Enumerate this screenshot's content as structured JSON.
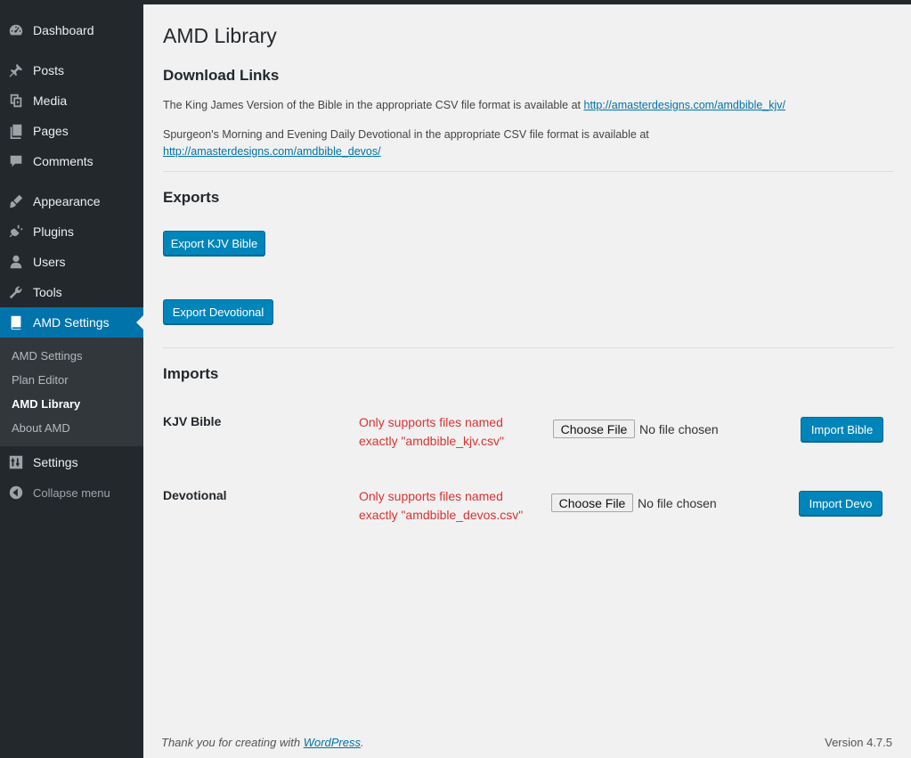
{
  "sidebar": {
    "items": [
      {
        "label": "Dashboard",
        "icon": "dashboard-icon"
      },
      {
        "label": "Posts",
        "icon": "pin-icon"
      },
      {
        "label": "Media",
        "icon": "media-icon"
      },
      {
        "label": "Pages",
        "icon": "pages-icon"
      },
      {
        "label": "Comments",
        "icon": "comment-icon"
      },
      {
        "label": "Appearance",
        "icon": "brush-icon"
      },
      {
        "label": "Plugins",
        "icon": "plugin-icon"
      },
      {
        "label": "Users",
        "icon": "user-icon"
      },
      {
        "label": "Tools",
        "icon": "wrench-icon"
      },
      {
        "label": "AMD Settings",
        "icon": "book-icon"
      }
    ],
    "submenu": [
      "AMD Settings",
      "Plan Editor",
      "AMD Library",
      "About AMD"
    ],
    "settings": "Settings",
    "collapse": "Collapse menu",
    "accent": "#0073aa"
  },
  "page": {
    "title": "AMD Library",
    "downloads": {
      "heading": "Download Links",
      "kjv_text": "The King James Version of the Bible in the appropriate CSV file format is available at",
      "kjv_link": "http://amasterdesigns.com/amdbible_kjv/",
      "devo_text": "Spurgeon's Morning and Evening Daily Devotional in the appropriate CSV file format is available at",
      "devo_link": "http://amasterdesigns.com/amdbible_devos/"
    },
    "exports": {
      "heading": "Exports",
      "kjv_button": "Export KJV Bible",
      "devo_button": "Export Devotional"
    },
    "imports": {
      "heading": "Imports",
      "rows": [
        {
          "label": "KJV Bible",
          "note1": "Only supports files named",
          "note2": "exactly \"amdbible_kjv.csv\"",
          "choose": "Choose File",
          "nofile": "No file chosen",
          "button": "Import Bible"
        },
        {
          "label": "Devotional",
          "note1": "Only supports files named",
          "note2": "exactly \"amdbible_devos.csv\"",
          "choose": "Choose File",
          "nofile": "No file chosen",
          "button": "Import Devo"
        }
      ]
    }
  },
  "footer": {
    "thanks": "Thank you for creating with",
    "wp_link": "WordPress",
    "period": ".",
    "version": "Version 4.7.5"
  }
}
